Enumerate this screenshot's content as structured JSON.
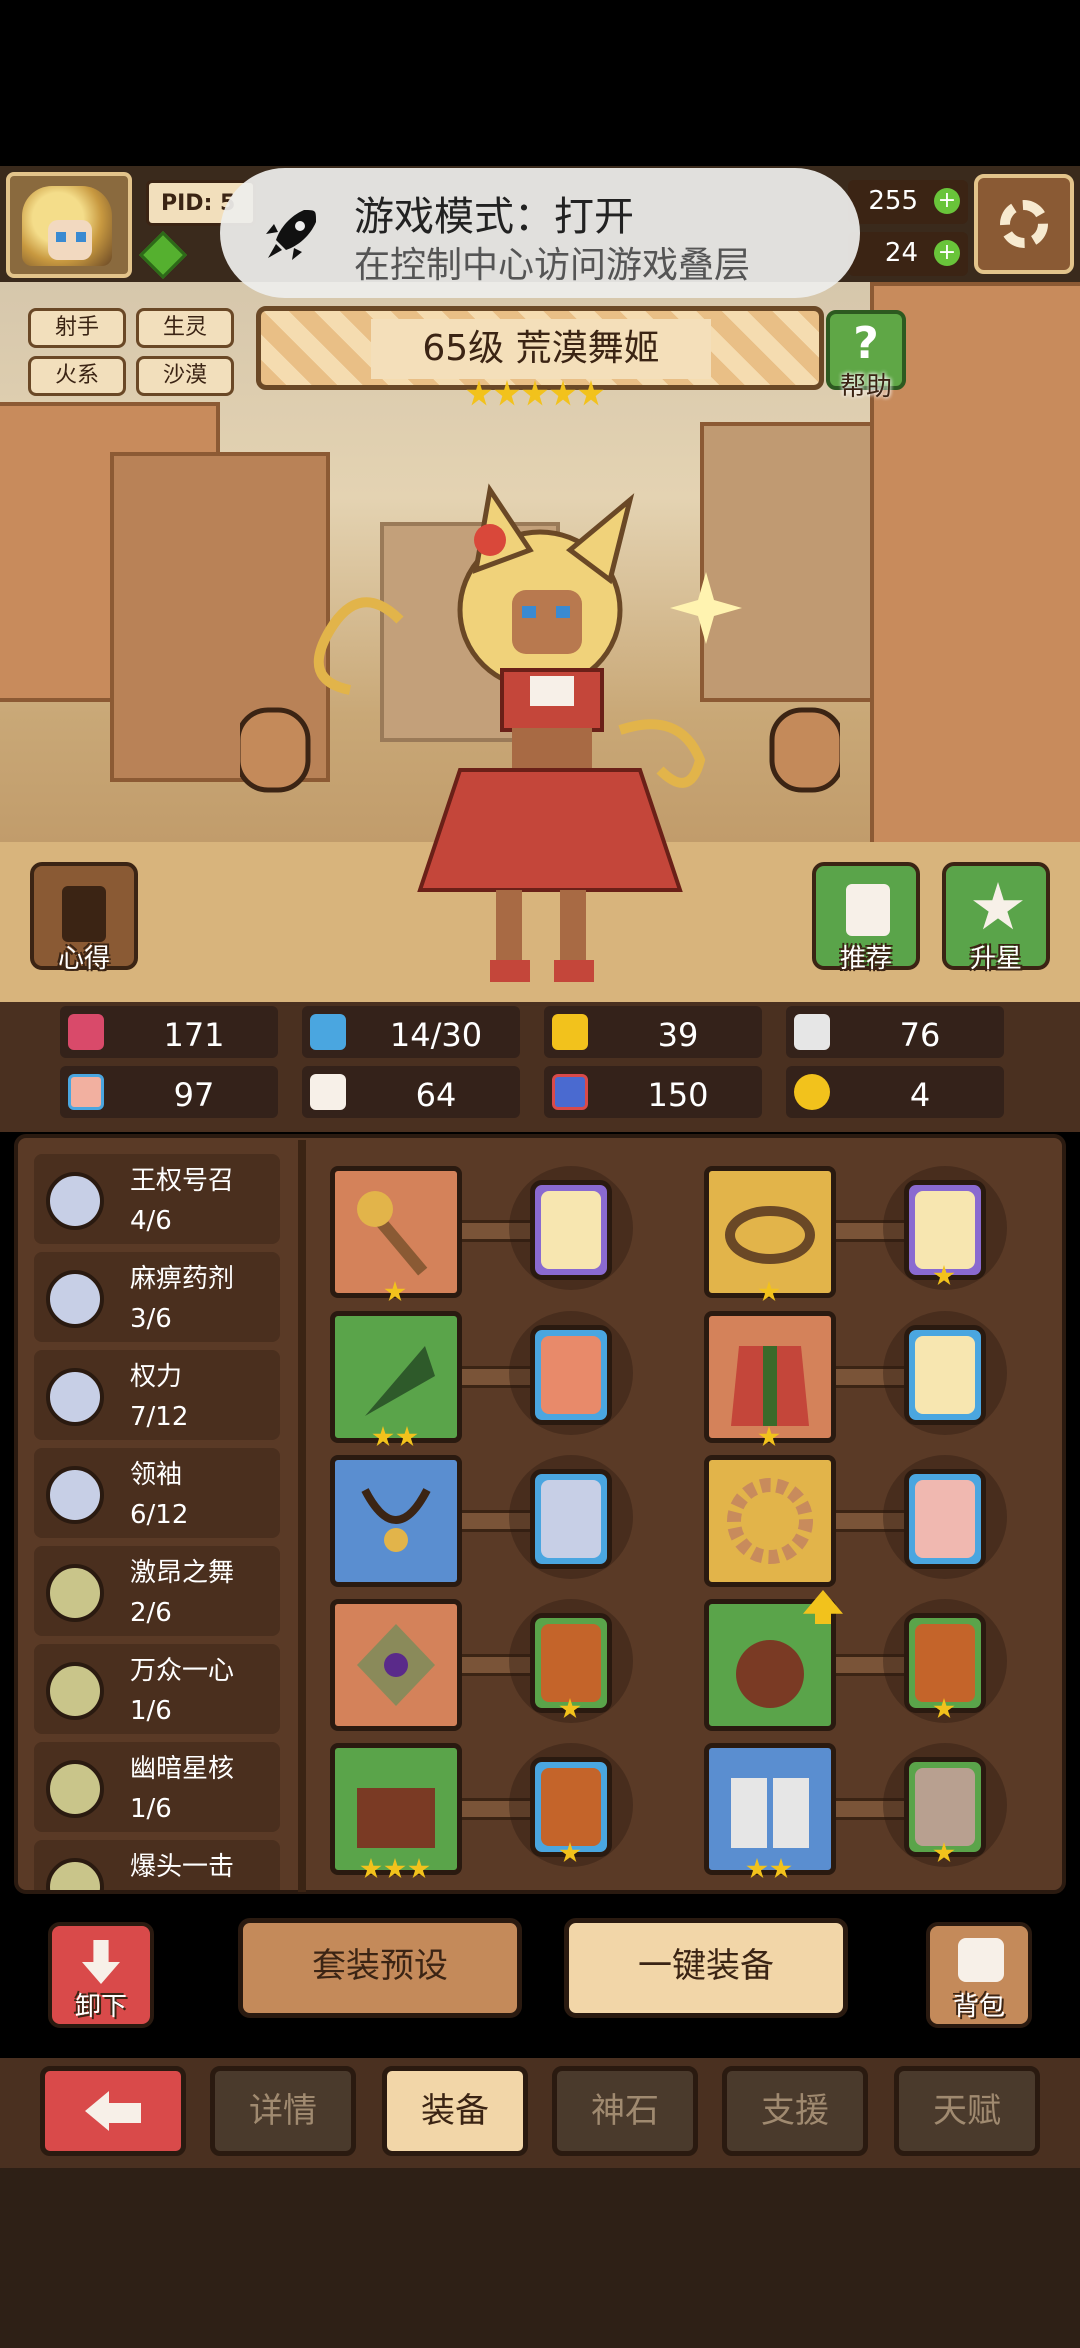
{
  "header": {
    "pid_label": "PID: 5",
    "gold_amount": "255",
    "gem_amount": "24"
  },
  "toast": {
    "title": "游戏模式：打开",
    "subtitle": "在控制中心访问游戏叠层"
  },
  "hero": {
    "tags": [
      "射手",
      "生灵",
      "火系",
      "沙漠"
    ],
    "title": "65级  荒漠舞姬",
    "star_count": 5,
    "help_label": "帮助",
    "notes_label": "心得",
    "recommend_label": "推荐",
    "upgrade_star_label": "升星"
  },
  "stats": {
    "row1": [
      "171",
      "14/30",
      "39",
      "76"
    ],
    "row2": [
      "97",
      "64",
      "150",
      "4"
    ]
  },
  "sets": [
    {
      "name": "王权号召",
      "count": "4/6",
      "color": "#c7cfe6"
    },
    {
      "name": "麻痹药剂",
      "count": "3/6",
      "color": "#c7cfe6"
    },
    {
      "name": "权力",
      "count": "7/12",
      "color": "#c7cfe6"
    },
    {
      "name": "领袖",
      "count": "6/12",
      "color": "#c7cfe6"
    },
    {
      "name": "激昂之舞",
      "count": "2/6",
      "color": "#c9c58a"
    },
    {
      "name": "万众一心",
      "count": "1/6",
      "color": "#c9c58a"
    },
    {
      "name": "幽暗星核",
      "count": "1/6",
      "color": "#c9c58a"
    },
    {
      "name": "爆头一击",
      "count": "",
      "color": "#c9c58a"
    }
  ],
  "equipment": {
    "left": [
      {
        "slot": "torch",
        "bg": "orange",
        "stars": 1,
        "card": "gold-card",
        "card_stars": 0
      },
      {
        "slot": "leaf-blade",
        "bg": "green",
        "stars": 2,
        "card": "pink-card",
        "card_stars": 0
      },
      {
        "slot": "necklace",
        "bg": "blue",
        "stars": 0,
        "card": "silver-card",
        "card_stars": 0
      },
      {
        "slot": "amulet",
        "bg": "orange",
        "stars": 0,
        "card": "fire-card",
        "card_stars": 1
      },
      {
        "slot": "chest",
        "bg": "green",
        "stars": 3,
        "card": "fire-card",
        "card_stars": 1
      }
    ],
    "right": [
      {
        "slot": "crown",
        "bg": "gold",
        "stars": 1,
        "card": "gold-card",
        "card_stars": 1
      },
      {
        "slot": "robe",
        "bg": "orange",
        "stars": 1,
        "card": "gold-card",
        "card_stars": 0
      },
      {
        "slot": "gear-ring",
        "bg": "gold",
        "stars": 0,
        "card": "pink-card",
        "card_stars": 0
      },
      {
        "slot": "pouch",
        "bg": "green",
        "stars": 0,
        "card": "fire-card",
        "card_stars": 1
      },
      {
        "slot": "boots",
        "bg": "blue",
        "stars": 2,
        "card": "stone-card",
        "card_stars": 1
      }
    ]
  },
  "actions": {
    "unequip_label": "卸下",
    "preset_label": "套装预设",
    "one_click_label": "一键装备",
    "bag_label": "背包"
  },
  "tabs": {
    "details": "详情",
    "equipment": "装备",
    "god_stone": "神石",
    "support": "支援",
    "talent": "天赋"
  },
  "colors": {
    "panel": "#5a3a26",
    "accent_green": "#5aa44a",
    "accent_red": "#d94a4a",
    "active_tab": "#f2d6a8"
  }
}
